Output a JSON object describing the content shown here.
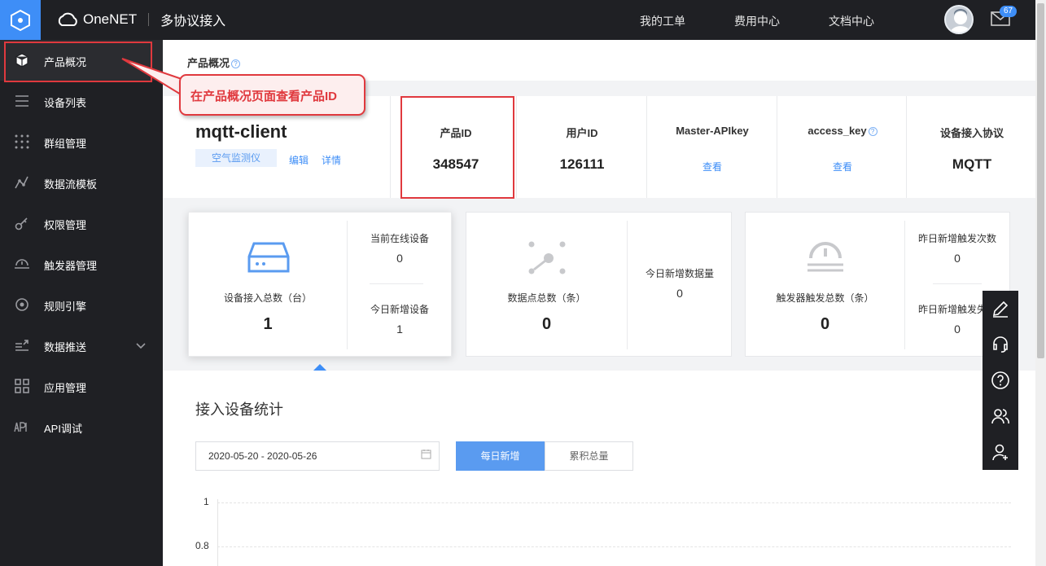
{
  "topbar": {
    "brand": "OneNET",
    "section": "多协议接入",
    "nav": [
      "我的工单",
      "费用中心",
      "文档中心"
    ],
    "mail_count": "67"
  },
  "sidebar": {
    "items": [
      {
        "label": "产品概况",
        "icon": "cube-icon"
      },
      {
        "label": "设备列表",
        "icon": "list-icon"
      },
      {
        "label": "群组管理",
        "icon": "grid-dots-icon"
      },
      {
        "label": "数据流模板",
        "icon": "stream-icon"
      },
      {
        "label": "权限管理",
        "icon": "key-icon"
      },
      {
        "label": "触发器管理",
        "icon": "trigger-icon"
      },
      {
        "label": "规则引擎",
        "icon": "rule-icon"
      },
      {
        "label": "数据推送",
        "icon": "push-icon"
      },
      {
        "label": "应用管理",
        "icon": "apps-icon"
      },
      {
        "label": "API调试",
        "icon": "api-icon"
      }
    ]
  },
  "page": {
    "title": "产品概况",
    "title_help": "?"
  },
  "product": {
    "name": "mqtt-client",
    "tag": "空气监测仪",
    "edit": "编辑",
    "detail": "详情"
  },
  "info": [
    {
      "key": "产品ID",
      "value": "348547"
    },
    {
      "key": "用户ID",
      "value": "126111"
    },
    {
      "key": "Master-APIkey",
      "link": "查看"
    },
    {
      "key": "access_key",
      "link": "查看",
      "help": "?"
    },
    {
      "key": "设备接入协议",
      "value": "MQTT"
    }
  ],
  "cards": [
    {
      "main_label": "设备接入总数（台）",
      "main_value": "1",
      "sub": [
        {
          "label": "当前在线设备",
          "value": "0"
        },
        {
          "label": "今日新增设备",
          "value": "1"
        }
      ]
    },
    {
      "main_label": "数据点总数（条）",
      "main_value": "0",
      "sub": [
        {
          "label": "今日新增数据量",
          "value": "0"
        }
      ]
    },
    {
      "main_label": "触发器触发总数（条）",
      "main_value": "0",
      "sub": [
        {
          "label": "昨日新增触发次数",
          "value": "0"
        },
        {
          "label": "昨日新增触发失败次数",
          "value": "0"
        }
      ]
    }
  ],
  "stats": {
    "title": "接入设备统计",
    "date_range": "2020-05-20 - 2020-05-26",
    "buttons": [
      "每日新增",
      "累积总量"
    ],
    "y_ticks": [
      "1",
      "0.8"
    ]
  },
  "callout": {
    "text": "在产品概况页面查看产品ID"
  },
  "colors": {
    "accent": "#3e8ef7",
    "annotation": "#e0393e",
    "dark": "#1f2024"
  }
}
